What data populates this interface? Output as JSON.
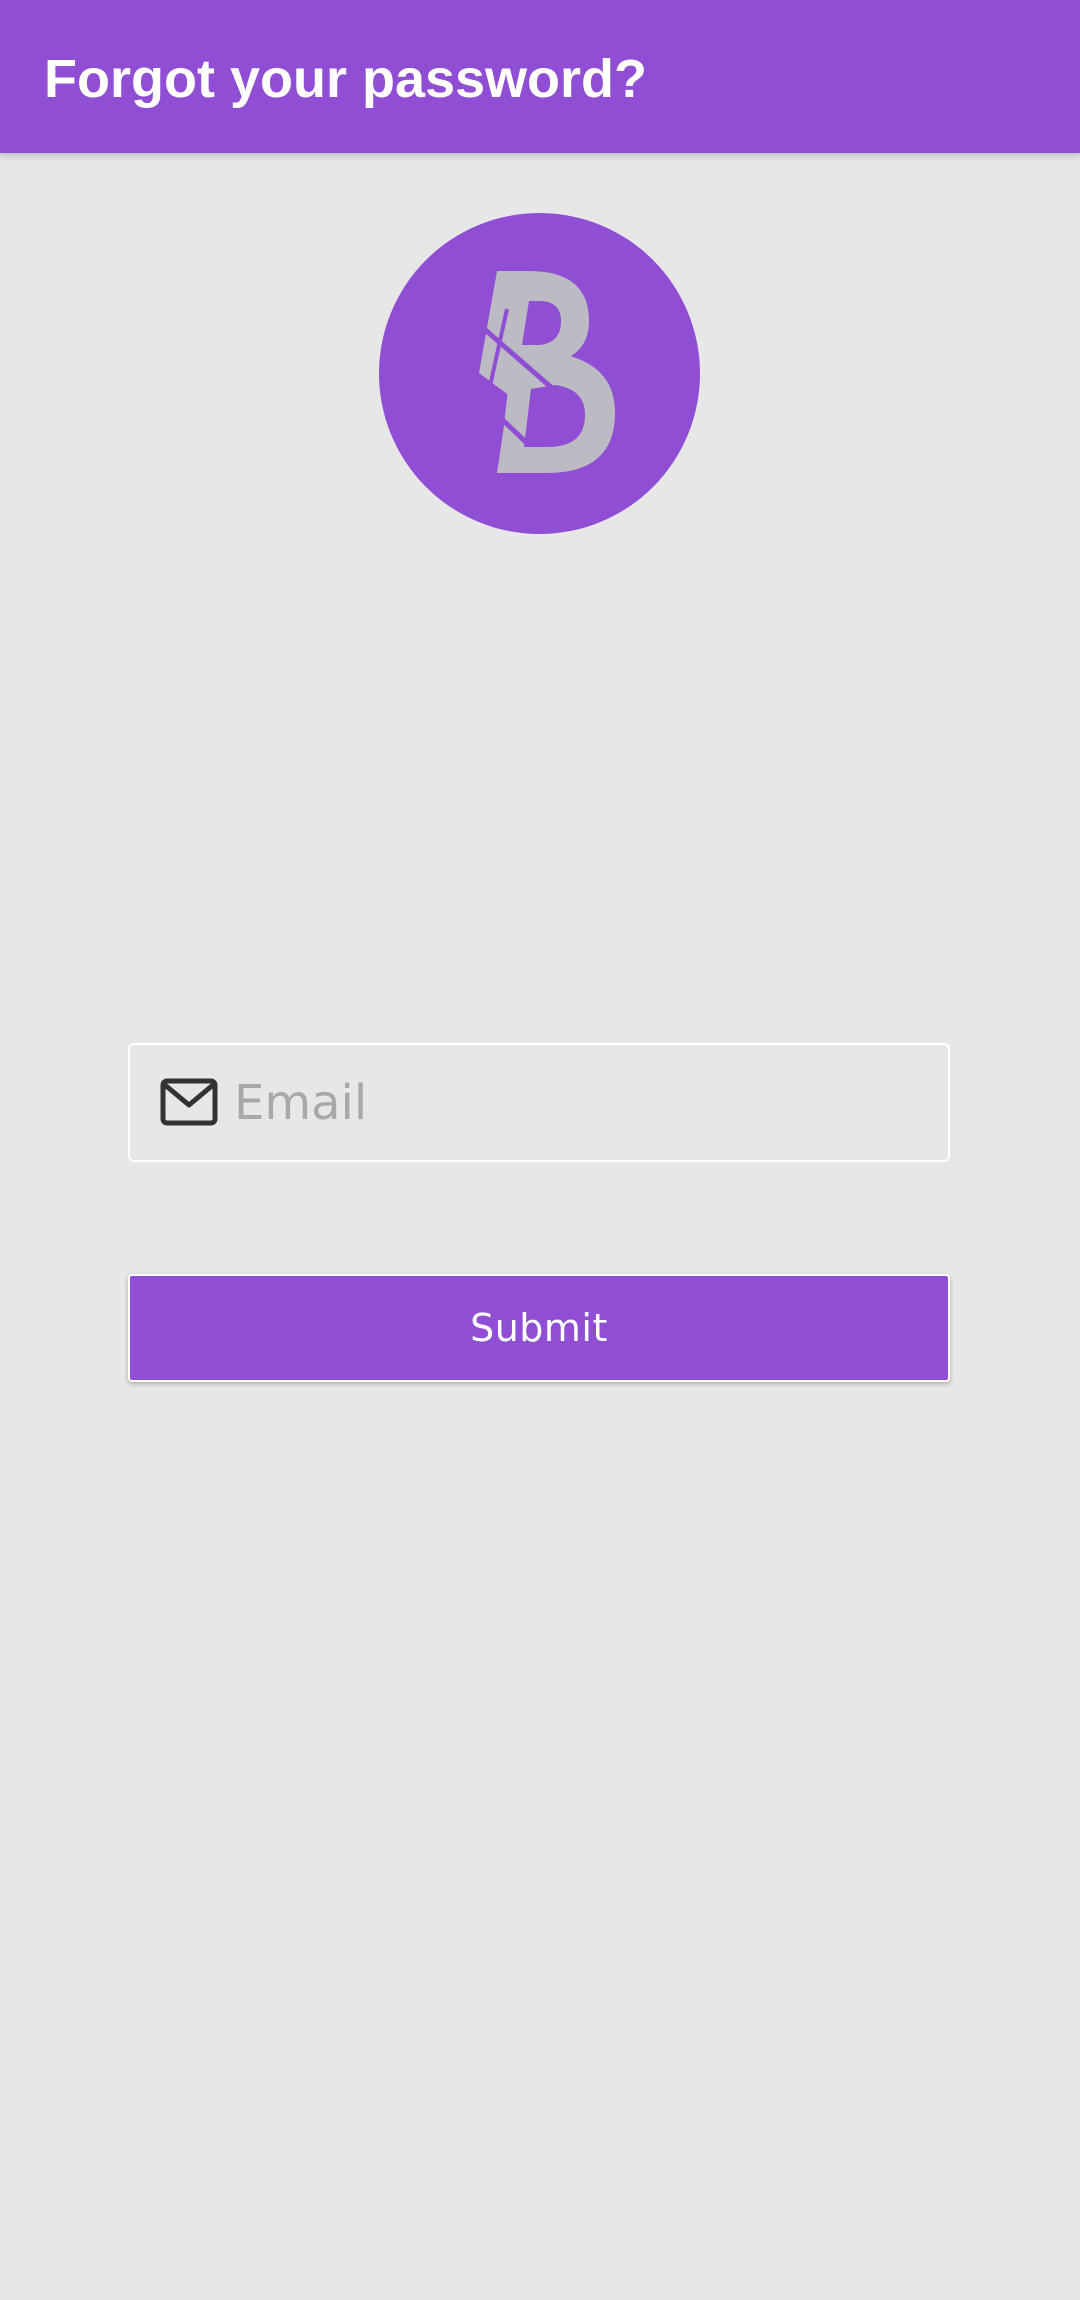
{
  "header": {
    "title": "Forgot your password?"
  },
  "logo": {
    "icon": "brand-logo-icon"
  },
  "form": {
    "email": {
      "icon": "mail-icon",
      "value": "",
      "placeholder": "Email"
    },
    "submit_label": "Submit"
  },
  "colors": {
    "primary": "#8f4ed3",
    "background": "#e7e7e7",
    "logo_glyph": "#bcbac2",
    "on_primary": "#ffffff",
    "placeholder": "#a8a8a8"
  }
}
